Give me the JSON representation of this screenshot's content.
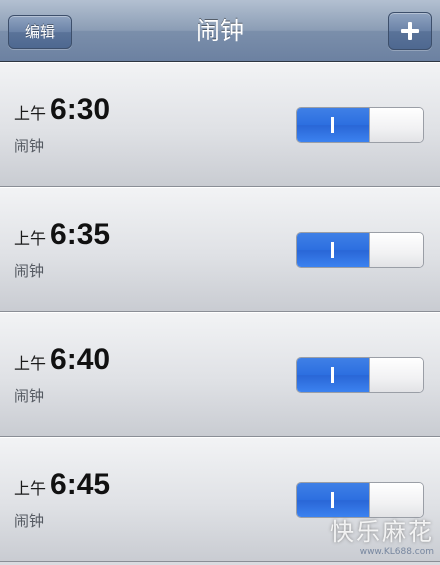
{
  "navbar": {
    "title": "闹钟",
    "edit_label": "编辑",
    "add_icon": "plus-icon"
  },
  "alarms": [
    {
      "period": "上午",
      "time": "6:30",
      "label": "闹钟",
      "enabled": true,
      "switch_on_label": "I"
    },
    {
      "period": "上午",
      "time": "6:35",
      "label": "闹钟",
      "enabled": true,
      "switch_on_label": "I"
    },
    {
      "period": "上午",
      "time": "6:40",
      "label": "闹钟",
      "enabled": true,
      "switch_on_label": "I"
    },
    {
      "period": "上午",
      "time": "6:45",
      "label": "闹钟",
      "enabled": true,
      "switch_on_label": "I"
    }
  ],
  "watermark": {
    "main": "快乐麻花",
    "sub": "www.KL688.com"
  },
  "colors": {
    "switch_on": "#2c6fe0",
    "navbar": "#7b8fab"
  }
}
